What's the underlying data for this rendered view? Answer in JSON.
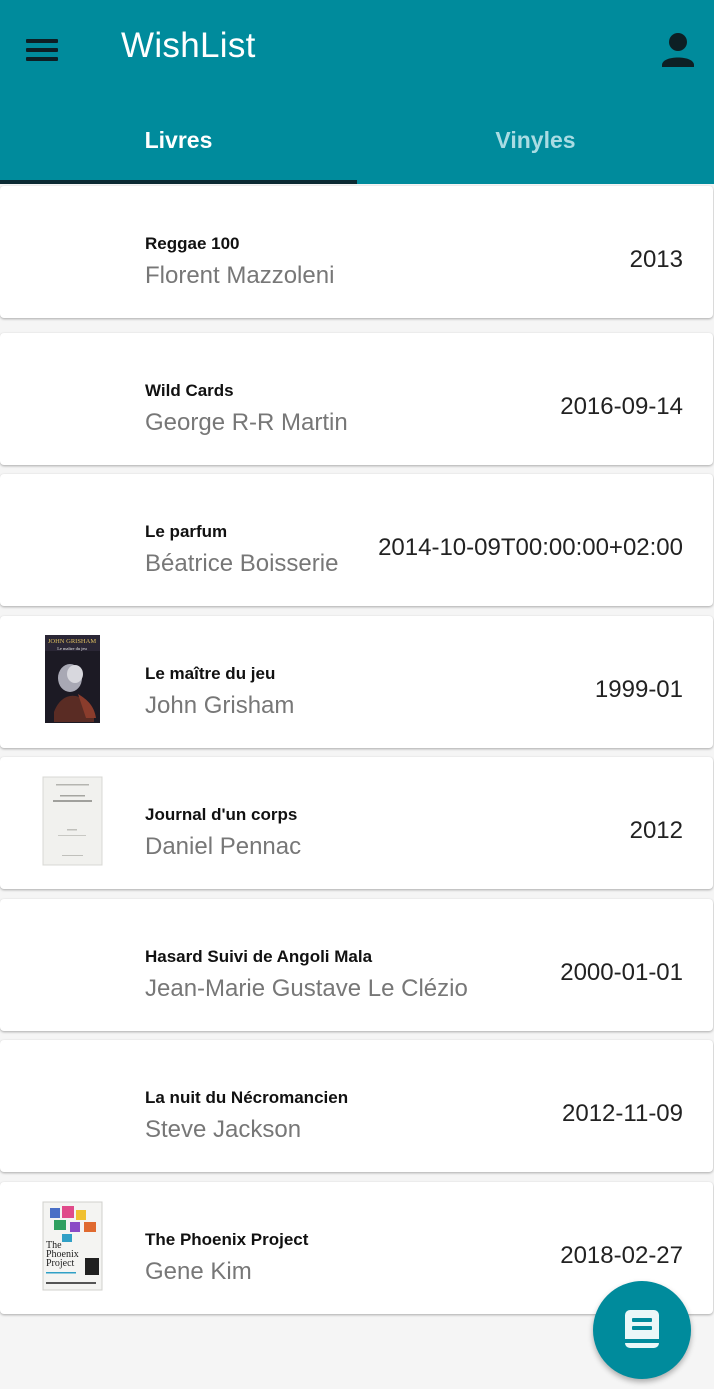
{
  "app": {
    "title": "WishList",
    "accent_color": "#008b9c",
    "menu_icon": "hamburger-menu-icon",
    "account_icon": "person-icon"
  },
  "tabs": [
    {
      "label": "Livres",
      "selected": true
    },
    {
      "label": "Vinyles",
      "selected": false
    }
  ],
  "books": [
    {
      "title": "Reggae 100",
      "author": "Florent Mazzoleni",
      "date": "2013",
      "cover": "none"
    },
    {
      "title": "Wild Cards",
      "author": "George R-R Martin",
      "date": "2016-09-14",
      "cover": "none"
    },
    {
      "title": "Le parfum",
      "author": "Béatrice Boisserie",
      "date": "2014-10-09T00:00:00+02:00",
      "cover": "none"
    },
    {
      "title": "Le maître du jeu",
      "author": "John Grisham",
      "date": "1999-01",
      "cover": "book-cover-image"
    },
    {
      "title": "Journal d'un corps",
      "author": "Daniel Pennac",
      "date": "2012",
      "cover": "book-cover-image"
    },
    {
      "title": "Hasard Suivi de Angoli Mala",
      "author": "Jean-Marie Gustave Le Clézio",
      "date": "2000-01-01",
      "cover": "none"
    },
    {
      "title": "La nuit du Nécromancien",
      "author": "Steve Jackson",
      "date": "2012-11-09",
      "cover": "none"
    },
    {
      "title": "The Phoenix Project",
      "author": "Gene Kim",
      "date": "2018-02-27",
      "cover": "book-cover-image"
    }
  ],
  "cover_texts": {
    "grisham_author": "JOHN GRISHAM",
    "grisham_title": "Le maître du jeu",
    "phoenix_title_line1": "The",
    "phoenix_title_line2": "Phoenix",
    "phoenix_title_line3": "Project"
  },
  "fab": {
    "icon": "book-icon"
  }
}
